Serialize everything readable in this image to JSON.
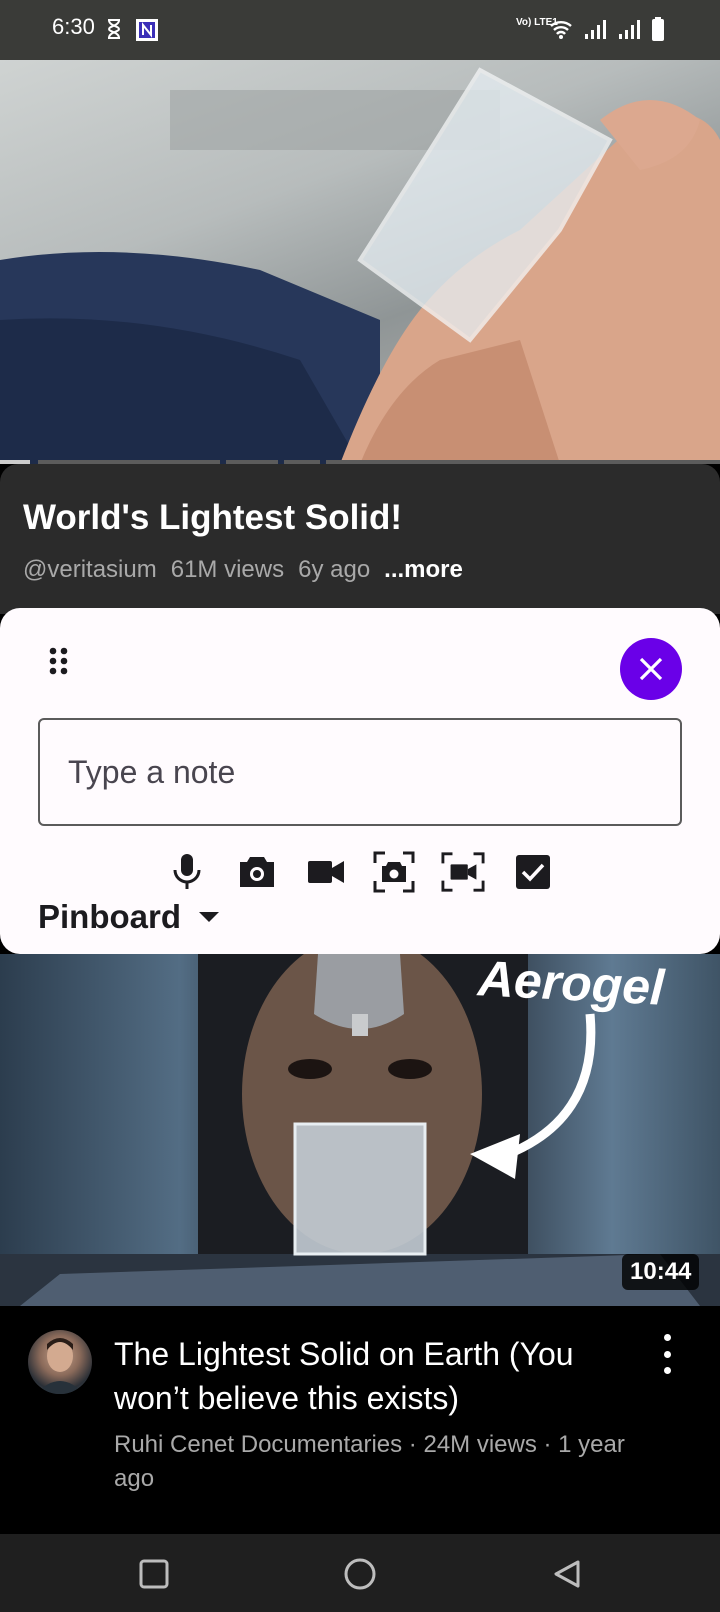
{
  "status_bar": {
    "time": "6:30",
    "icons": [
      "hourglass-icon",
      "app-notification-icon",
      "volte-icon",
      "wifi-icon",
      "signal-icon",
      "signal-icon",
      "battery-icon"
    ],
    "volte_label": "Vo) LTE1"
  },
  "video": {
    "title": "World's Lightest Solid!",
    "channel": "@veritasium",
    "views": "61M views",
    "age": "6y ago",
    "more_label": "...more"
  },
  "note_panel": {
    "placeholder": "Type a note",
    "input_value": "",
    "tools": [
      "microphone-icon",
      "camera-icon",
      "video-camera-icon",
      "screenshot-icon",
      "screen-record-icon",
      "checkbox-icon"
    ],
    "board_label": "Pinboard",
    "accent_color": "#6a00e8"
  },
  "recommended": {
    "overlay_text": "Aerogel",
    "duration": "10:44",
    "title": "The Lightest Solid on Earth (You won’t believe this exists)",
    "meta": "Ruhi Cenet Documentaries · 24M views · 1 year ago"
  },
  "nav_bar": {
    "buttons": [
      "recents-button",
      "home-button",
      "back-button"
    ]
  }
}
